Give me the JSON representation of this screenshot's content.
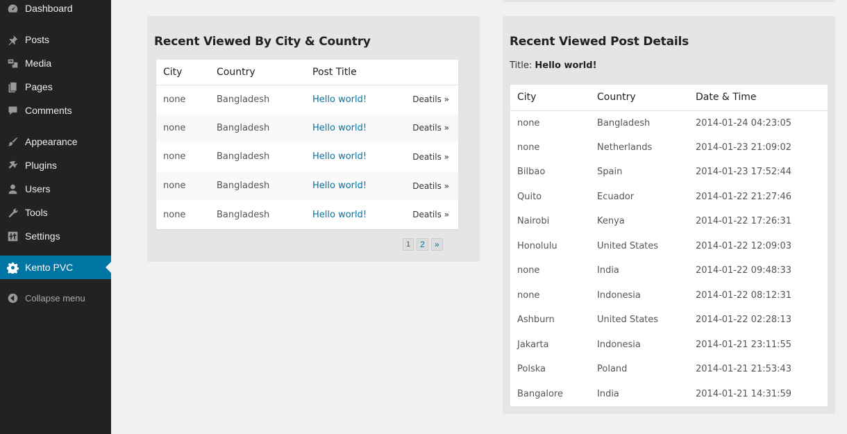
{
  "sidebar": {
    "items": [
      {
        "label": "Dashboard",
        "icon": "dashboard-icon"
      },
      {
        "label": "Posts",
        "icon": "pin-icon"
      },
      {
        "label": "Media",
        "icon": "media-icon"
      },
      {
        "label": "Pages",
        "icon": "pages-icon"
      },
      {
        "label": "Comments",
        "icon": "comment-icon"
      },
      {
        "label": "Appearance",
        "icon": "brush-icon"
      },
      {
        "label": "Plugins",
        "icon": "plug-icon"
      },
      {
        "label": "Users",
        "icon": "user-icon"
      },
      {
        "label": "Tools",
        "icon": "wrench-icon"
      },
      {
        "label": "Settings",
        "icon": "sliders-icon"
      },
      {
        "label": "Kento PVC",
        "icon": "gear-icon"
      }
    ],
    "collapse_label": "Collapse menu",
    "active_color": "#0074a2"
  },
  "city_panel": {
    "title": "Recent Viewed By City & Country",
    "headers": [
      "City",
      "Country",
      "Post Title"
    ],
    "rows": [
      {
        "city": "none",
        "country": "Bangladesh",
        "post": "Hello world!",
        "details": "Deatils »"
      },
      {
        "city": "none",
        "country": "Bangladesh",
        "post": "Hello world!",
        "details": "Deatils »"
      },
      {
        "city": "none",
        "country": "Bangladesh",
        "post": "Hello world!",
        "details": "Deatils »"
      },
      {
        "city": "none",
        "country": "Bangladesh",
        "post": "Hello world!",
        "details": "Deatils »"
      },
      {
        "city": "none",
        "country": "Bangladesh",
        "post": "Hello world!",
        "details": "Deatils »"
      }
    ],
    "pagination": [
      "1",
      "2",
      "»"
    ]
  },
  "details_panel": {
    "title": "Recent Viewed Post Details",
    "post_title_label": "Title:",
    "post_title_value": "Hello world!",
    "headers": [
      "City",
      "Country",
      "Date & Time"
    ],
    "rows": [
      {
        "city": "none",
        "country": "Bangladesh",
        "datetime": "2014-01-24 04:23:05"
      },
      {
        "city": "none",
        "country": "Netherlands",
        "datetime": "2014-01-23 21:09:02"
      },
      {
        "city": "Bilbao",
        "country": "Spain",
        "datetime": "2014-01-23 17:52:44"
      },
      {
        "city": "Quito",
        "country": "Ecuador",
        "datetime": "2014-01-22 21:27:46"
      },
      {
        "city": "Nairobi",
        "country": "Kenya",
        "datetime": "2014-01-22 17:26:31"
      },
      {
        "city": "Honolulu",
        "country": "United States",
        "datetime": "2014-01-22 12:09:03"
      },
      {
        "city": "none",
        "country": "India",
        "datetime": "2014-01-22 09:48:33"
      },
      {
        "city": "none",
        "country": "Indonesia",
        "datetime": "2014-01-22 08:12:31"
      },
      {
        "city": "Ashburn",
        "country": "United States",
        "datetime": "2014-01-22 02:28:13"
      },
      {
        "city": "Jakarta",
        "country": "Indonesia",
        "datetime": "2014-01-21 23:11:55"
      },
      {
        "city": "Polska",
        "country": "Poland",
        "datetime": "2014-01-21 21:53:43"
      },
      {
        "city": "Bangalore",
        "country": "India",
        "datetime": "2014-01-21 14:31:59"
      }
    ]
  }
}
